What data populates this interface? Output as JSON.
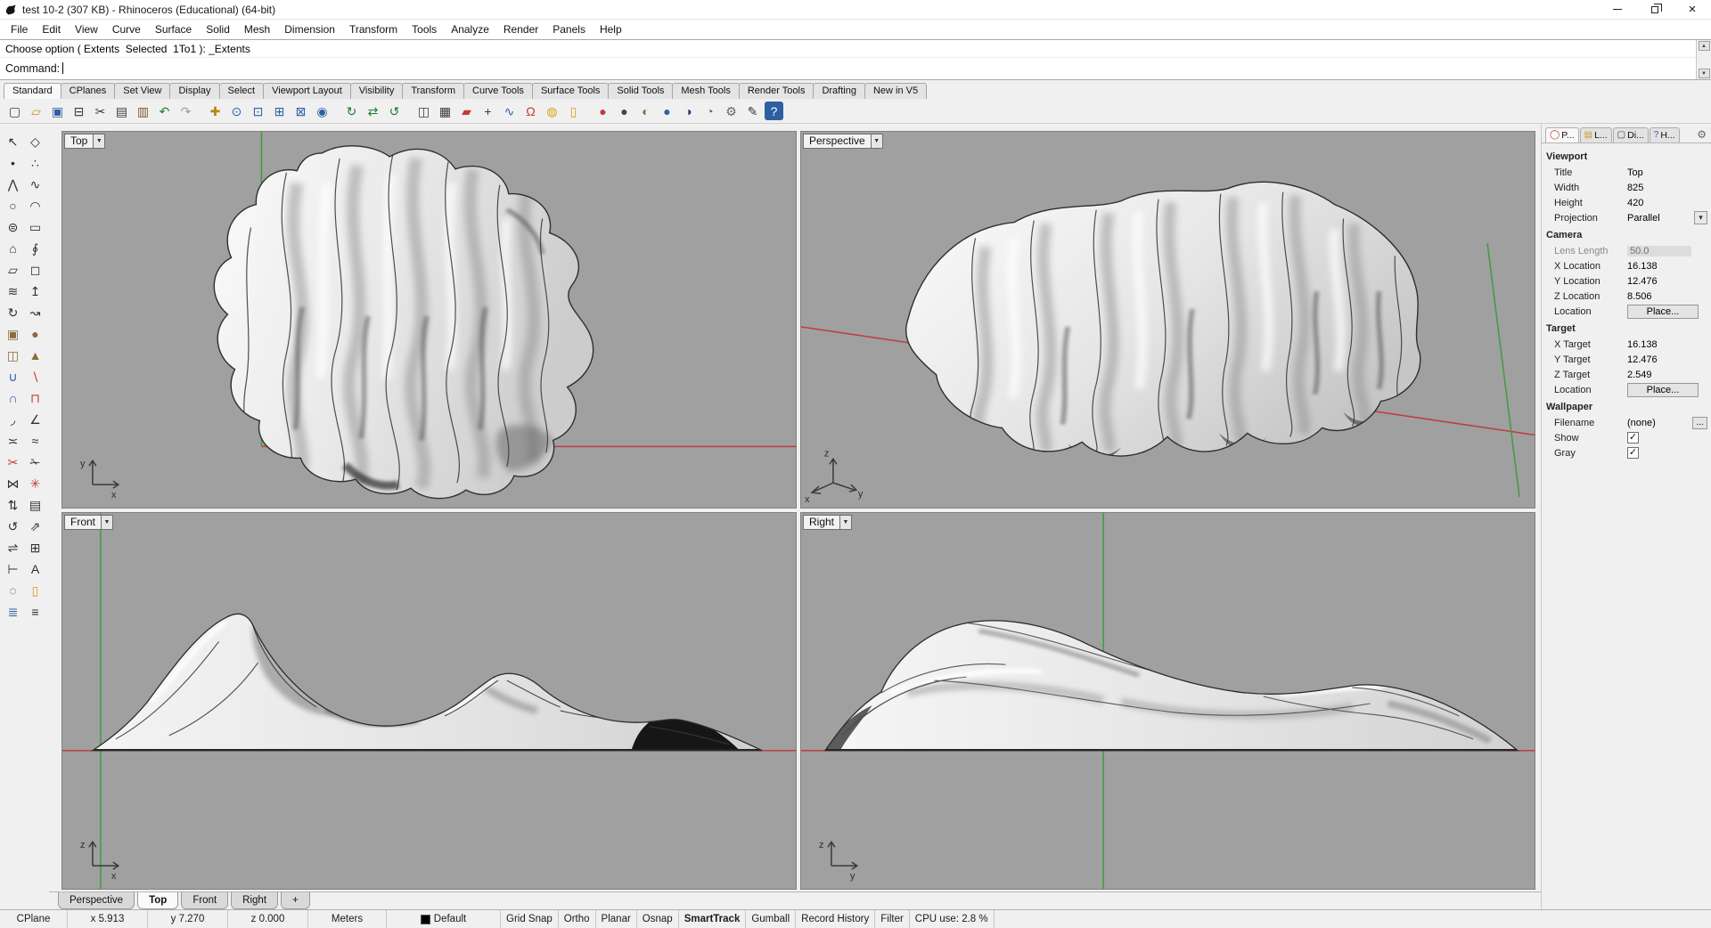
{
  "window": {
    "title": "test 10-2 (307 KB) - Rhinoceros (Educational) (64-bit)"
  },
  "colors": {
    "axis_x_red": "#c03c3c",
    "axis_y_green": "#3f9b3f",
    "viewport_bg": "#a0a0a0",
    "layer_swatch": "#000000",
    "accent_blue": "#2e5fa3"
  },
  "menu": {
    "items": [
      {
        "name": "menu-item-file",
        "label": "File"
      },
      {
        "name": "menu-item-edit",
        "label": "Edit"
      },
      {
        "name": "menu-item-view",
        "label": "View"
      },
      {
        "name": "menu-item-curve",
        "label": "Curve"
      },
      {
        "name": "menu-item-surface",
        "label": "Surface"
      },
      {
        "name": "menu-item-solid",
        "label": "Solid"
      },
      {
        "name": "menu-item-mesh",
        "label": "Mesh"
      },
      {
        "name": "menu-item-dimension",
        "label": "Dimension"
      },
      {
        "name": "menu-item-transform",
        "label": "Transform"
      },
      {
        "name": "menu-item-tools",
        "label": "Tools"
      },
      {
        "name": "menu-item-analyze",
        "label": "Analyze"
      },
      {
        "name": "menu-item-render",
        "label": "Render"
      },
      {
        "name": "menu-item-panels",
        "label": "Panels"
      },
      {
        "name": "menu-item-help",
        "label": "Help"
      }
    ]
  },
  "command": {
    "history_line": "Choose option ( Extents  Selected  1To1 ): _Extents",
    "prompt_label": "Command:"
  },
  "toolbar_tabs": {
    "items": [
      {
        "name": "toolbar-tab-standard",
        "label": "Standard",
        "active": true
      },
      {
        "name": "toolbar-tab-cplanes",
        "label": "CPlanes"
      },
      {
        "name": "toolbar-tab-set-view",
        "label": "Set View"
      },
      {
        "name": "toolbar-tab-display",
        "label": "Display"
      },
      {
        "name": "toolbar-tab-select",
        "label": "Select"
      },
      {
        "name": "toolbar-tab-viewport-layout",
        "label": "Viewport Layout"
      },
      {
        "name": "toolbar-tab-visibility",
        "label": "Visibility"
      },
      {
        "name": "toolbar-tab-transform",
        "label": "Transform"
      },
      {
        "name": "toolbar-tab-curve-tools",
        "label": "Curve Tools"
      },
      {
        "name": "toolbar-tab-surface-tools",
        "label": "Surface Tools"
      },
      {
        "name": "toolbar-tab-solid-tools",
        "label": "Solid Tools"
      },
      {
        "name": "toolbar-tab-mesh-tools",
        "label": "Mesh Tools"
      },
      {
        "name": "toolbar-tab-render-tools",
        "label": "Render Tools"
      },
      {
        "name": "toolbar-tab-drafting",
        "label": "Drafting"
      },
      {
        "name": "toolbar-tab-new-in-v5",
        "label": "New in V5"
      }
    ]
  },
  "toolbar_icons": {
    "items": [
      {
        "name": "new-file-icon",
        "glyph": "▢",
        "color": "#3a3a3a"
      },
      {
        "name": "open-file-icon",
        "glyph": "▱",
        "color": "#c89b2a"
      },
      {
        "name": "save-icon",
        "glyph": "▣",
        "color": "#2e5fa3"
      },
      {
        "name": "print-icon",
        "glyph": "⊟",
        "color": "#3a3a3a"
      },
      {
        "name": "cut-icon",
        "glyph": "✂",
        "color": "#3a3a3a"
      },
      {
        "name": "copy-icon",
        "glyph": "▤",
        "color": "#3a3a3a"
      },
      {
        "name": "paste-icon",
        "glyph": "▥",
        "color": "#7a5c2e"
      },
      {
        "name": "undo-icon",
        "glyph": "↶",
        "color": "#1f7a33"
      },
      {
        "name": "redo-icon",
        "glyph": "↷",
        "color": "#9a9a9a"
      },
      {
        "name": "pan-icon",
        "glyph": "✚",
        "color": "#b8860b",
        "gap": true
      },
      {
        "name": "zoom-dynamic-icon",
        "glyph": "⊙",
        "color": "#2e5fa3"
      },
      {
        "name": "zoom-window-icon",
        "glyph": "⊡",
        "color": "#2e5fa3"
      },
      {
        "name": "zoom-extents-icon",
        "glyph": "⊞",
        "color": "#2e5fa3"
      },
      {
        "name": "zoom-extents-all-icon",
        "glyph": "⊠",
        "color": "#2e5fa3"
      },
      {
        "name": "zoom-selected-icon",
        "glyph": "◉",
        "color": "#2e5fa3"
      },
      {
        "name": "rotate-view-icon",
        "glyph": "↻",
        "color": "#1f7a33",
        "gap": true
      },
      {
        "name": "pan-view-icon",
        "glyph": "⇄",
        "color": "#1f7a33"
      },
      {
        "name": "undo-view-icon",
        "glyph": "↺",
        "color": "#1f7a33"
      },
      {
        "name": "viewport-layout-icon",
        "glyph": "◫",
        "color": "#3a3a3a",
        "gap": true
      },
      {
        "name": "grid-table-icon",
        "glyph": "▦",
        "color": "#3a3a3a"
      },
      {
        "name": "render-speed-icon",
        "glyph": "▰",
        "color": "#c23b3b"
      },
      {
        "name": "move-object-icon",
        "glyph": "+",
        "color": "#3a3a3a"
      },
      {
        "name": "curve-tools-icon",
        "glyph": "∿",
        "color": "#2e5fa3"
      },
      {
        "name": "osnap-magnet-icon",
        "glyph": "Ω",
        "color": "#c23b3b"
      },
      {
        "name": "lamp-icon",
        "glyph": "◍",
        "color": "#d6a516"
      },
      {
        "name": "lock-toolbar-icon",
        "glyph": "▯",
        "color": "#c9a227"
      },
      {
        "name": "render-icon",
        "glyph": "●",
        "color": "#c23b3b",
        "gap": true
      },
      {
        "name": "render-preview-icon",
        "glyph": "●",
        "color": "#444444"
      },
      {
        "name": "material-icon",
        "glyph": "◐",
        "color": "#8a6d3b"
      },
      {
        "name": "globe-icon",
        "glyph": "●",
        "color": "#2e5fa3"
      },
      {
        "name": "globe-dark-icon",
        "glyph": "◑",
        "color": "#1d3f7a"
      },
      {
        "name": "checker-ball-icon",
        "glyph": "◔",
        "color": "#666666"
      },
      {
        "name": "gear-icon",
        "glyph": "⚙",
        "color": "#666666"
      },
      {
        "name": "pencil-icon",
        "glyph": "✎",
        "color": "#3a3a3a"
      },
      {
        "name": "help-icon",
        "glyph": "?",
        "color": "#ffffff",
        "bg": "#2e5fa3"
      }
    ]
  },
  "left_toolbar": {
    "items": [
      {
        "name": "select-arrow-icon",
        "glyph": "↖",
        "color": "#2f2f2f"
      },
      {
        "name": "select-points-icon",
        "glyph": "◇",
        "color": "#2f2f2f"
      },
      {
        "name": "point-icon",
        "glyph": "•",
        "color": "#2f2f2f"
      },
      {
        "name": "point-cloud-icon",
        "glyph": "∴",
        "color": "#2f2f2f"
      },
      {
        "name": "polyline-icon",
        "glyph": "⋀",
        "color": "#2f2f2f"
      },
      {
        "name": "curve-icon",
        "glyph": "∿",
        "color": "#2f2f2f"
      },
      {
        "name": "circle-icon",
        "glyph": "○",
        "color": "#2f2f2f"
      },
      {
        "name": "arc-icon",
        "glyph": "◠",
        "color": "#2f2f2f"
      },
      {
        "name": "ellipse-icon",
        "glyph": "⊜",
        "color": "#2f2f2f"
      },
      {
        "name": "rectangle-icon",
        "glyph": "▭",
        "color": "#2f2f2f"
      },
      {
        "name": "polygon-icon",
        "glyph": "⌂",
        "color": "#2f2f2f"
      },
      {
        "name": "helix-icon",
        "glyph": "∮",
        "color": "#2f2f2f"
      },
      {
        "name": "surface-plane-icon",
        "glyph": "▱",
        "color": "#2f2f2f"
      },
      {
        "name": "surface-corners-icon",
        "glyph": "◻",
        "color": "#2f2f2f"
      },
      {
        "name": "loft-icon",
        "glyph": "≋",
        "color": "#2f2f2f"
      },
      {
        "name": "extrude-icon",
        "glyph": "↥",
        "color": "#2f2f2f"
      },
      {
        "name": "revolve-icon",
        "glyph": "↻",
        "color": "#2f2f2f"
      },
      {
        "name": "sweep-icon",
        "glyph": "↝",
        "color": "#2f2f2f"
      },
      {
        "name": "box-icon",
        "glyph": "▣",
        "color": "#8a6d3b"
      },
      {
        "name": "sphere-icon",
        "glyph": "●",
        "color": "#8a6d3b"
      },
      {
        "name": "cylinder-icon",
        "glyph": "◫",
        "color": "#8a6d3b"
      },
      {
        "name": "cone-icon",
        "glyph": "▲",
        "color": "#8a6d3b"
      },
      {
        "name": "boolean-union-icon",
        "glyph": "∪",
        "color": "#2e5fa3"
      },
      {
        "name": "boolean-difference-icon",
        "glyph": "∖",
        "color": "#c23b3b"
      },
      {
        "name": "boolean-intersection-icon",
        "glyph": "∩",
        "color": "#2e5fa3"
      },
      {
        "name": "boolean-split-icon",
        "glyph": "⊓",
        "color": "#c23b3b"
      },
      {
        "name": "fillet-icon",
        "glyph": "◞",
        "color": "#2f2f2f"
      },
      {
        "name": "chamfer-icon",
        "glyph": "∠",
        "color": "#2f2f2f"
      },
      {
        "name": "offset-icon",
        "glyph": "≍",
        "color": "#2f2f2f"
      },
      {
        "name": "blend-icon",
        "glyph": "≈",
        "color": "#2f2f2f"
      },
      {
        "name": "trim-icon",
        "glyph": "✂",
        "color": "#c23b3b"
      },
      {
        "name": "split-icon",
        "glyph": "✁",
        "color": "#2f2f2f"
      },
      {
        "name": "join-icon",
        "glyph": "⋈",
        "color": "#2f2f2f"
      },
      {
        "name": "explode-icon",
        "glyph": "✳",
        "color": "#c23b3b"
      },
      {
        "name": "move-icon",
        "glyph": "⇅",
        "color": "#2f2f2f"
      },
      {
        "name": "copy-object-icon",
        "glyph": "▤",
        "color": "#2f2f2f"
      },
      {
        "name": "rotate-icon",
        "glyph": "↺",
        "color": "#2f2f2f"
      },
      {
        "name": "scale-icon",
        "glyph": "⇗",
        "color": "#2f2f2f"
      },
      {
        "name": "mirror-icon",
        "glyph": "⇌",
        "color": "#2f2f2f"
      },
      {
        "name": "array-icon",
        "glyph": "⊞",
        "color": "#2f2f2f"
      },
      {
        "name": "dimension-icon",
        "glyph": "⊢",
        "color": "#2f2f2f"
      },
      {
        "name": "text-icon",
        "glyph": "A",
        "color": "#2f2f2f"
      },
      {
        "name": "hide-icon",
        "glyph": "◌",
        "color": "#2f2f2f"
      },
      {
        "name": "lock-icon",
        "glyph": "▯",
        "color": "#c9a227"
      },
      {
        "name": "layers-icon",
        "glyph": "≣",
        "color": "#2e5fa3"
      },
      {
        "name": "properties-icon",
        "glyph": "≡",
        "color": "#2f2f2f"
      }
    ]
  },
  "viewports": {
    "top": {
      "label": "Top",
      "axes": {
        "v": "y",
        "h": "x"
      }
    },
    "perspective": {
      "label": "Perspective",
      "axes": {
        "up": "z",
        "right": "y",
        "left": "x"
      }
    },
    "front": {
      "label": "Front",
      "axes": {
        "v": "z",
        "h": "x"
      }
    },
    "right": {
      "label": "Right",
      "axes": {
        "v": "z",
        "h": "y"
      }
    }
  },
  "panel": {
    "tabs": {
      "items": [
        {
          "name": "panel-tab-properties",
          "label": "P...",
          "icon": "◯",
          "icon_color": "#c23b3b",
          "active": true
        },
        {
          "name": "panel-tab-layers",
          "label": "L...",
          "icon": "▤",
          "icon_color": "#c89b2a"
        },
        {
          "name": "panel-tab-display",
          "label": "Di...",
          "icon": "▢",
          "icon_color": "#3a3a3a"
        },
        {
          "name": "panel-tab-help",
          "label": "H...",
          "icon": "?",
          "icon_color": "#2e5fa3"
        }
      ]
    },
    "viewport_section": {
      "title": "Viewport",
      "title_row": {
        "label": "Title",
        "value": "Top"
      },
      "width_row": {
        "label": "Width",
        "value": "825"
      },
      "height_row": {
        "label": "Height",
        "value": "420"
      },
      "projection_row": {
        "label": "Projection",
        "value": "Parallel"
      }
    },
    "camera_section": {
      "title": "Camera",
      "lens_row": {
        "label": "Lens Length",
        "value": "50.0"
      },
      "x_row": {
        "label": "X Location",
        "value": "16.138"
      },
      "y_row": {
        "label": "Y Location",
        "value": "12.476"
      },
      "z_row": {
        "label": "Z Location",
        "value": "8.506"
      },
      "location_row": {
        "label": "Location",
        "button": "Place..."
      }
    },
    "target_section": {
      "title": "Target",
      "x_row": {
        "label": "X Target",
        "value": "16.138"
      },
      "y_row": {
        "label": "Y Target",
        "value": "12.476"
      },
      "z_row": {
        "label": "Z Target",
        "value": "2.549"
      },
      "location_row": {
        "label": "Location",
        "button": "Place..."
      }
    },
    "wallpaper_section": {
      "title": "Wallpaper",
      "filename_row": {
        "label": "Filename",
        "value": "(none)",
        "browse": "..."
      },
      "show_row": {
        "label": "Show",
        "checked": true
      },
      "gray_row": {
        "label": "Gray",
        "checked": true
      }
    }
  },
  "viewport_tabs": {
    "items": [
      {
        "name": "viewport-tab-perspective",
        "label": "Perspective"
      },
      {
        "name": "viewport-tab-top",
        "label": "Top",
        "active": true
      },
      {
        "name": "viewport-tab-front",
        "label": "Front"
      },
      {
        "name": "viewport-tab-right",
        "label": "Right"
      },
      {
        "name": "viewport-tab-new",
        "label": "+"
      }
    ]
  },
  "status_bar": {
    "cplane": "CPlane",
    "x": "x 5.913",
    "y": "y 7.270",
    "z": "z 0.000",
    "units": "Meters",
    "layer": "Default",
    "toggles": [
      {
        "name": "status-grid-snap",
        "label": "Grid Snap"
      },
      {
        "name": "status-ortho",
        "label": "Ortho"
      },
      {
        "name": "status-planar",
        "label": "Planar"
      },
      {
        "name": "status-osnap",
        "label": "Osnap"
      },
      {
        "name": "status-smarttrack",
        "label": "SmartTrack",
        "bold": true
      },
      {
        "name": "status-gumball",
        "label": "Gumball"
      },
      {
        "name": "status-record-history",
        "label": "Record History"
      },
      {
        "name": "status-filter",
        "label": "Filter"
      }
    ],
    "cpu": "CPU use: 2.8 %"
  }
}
